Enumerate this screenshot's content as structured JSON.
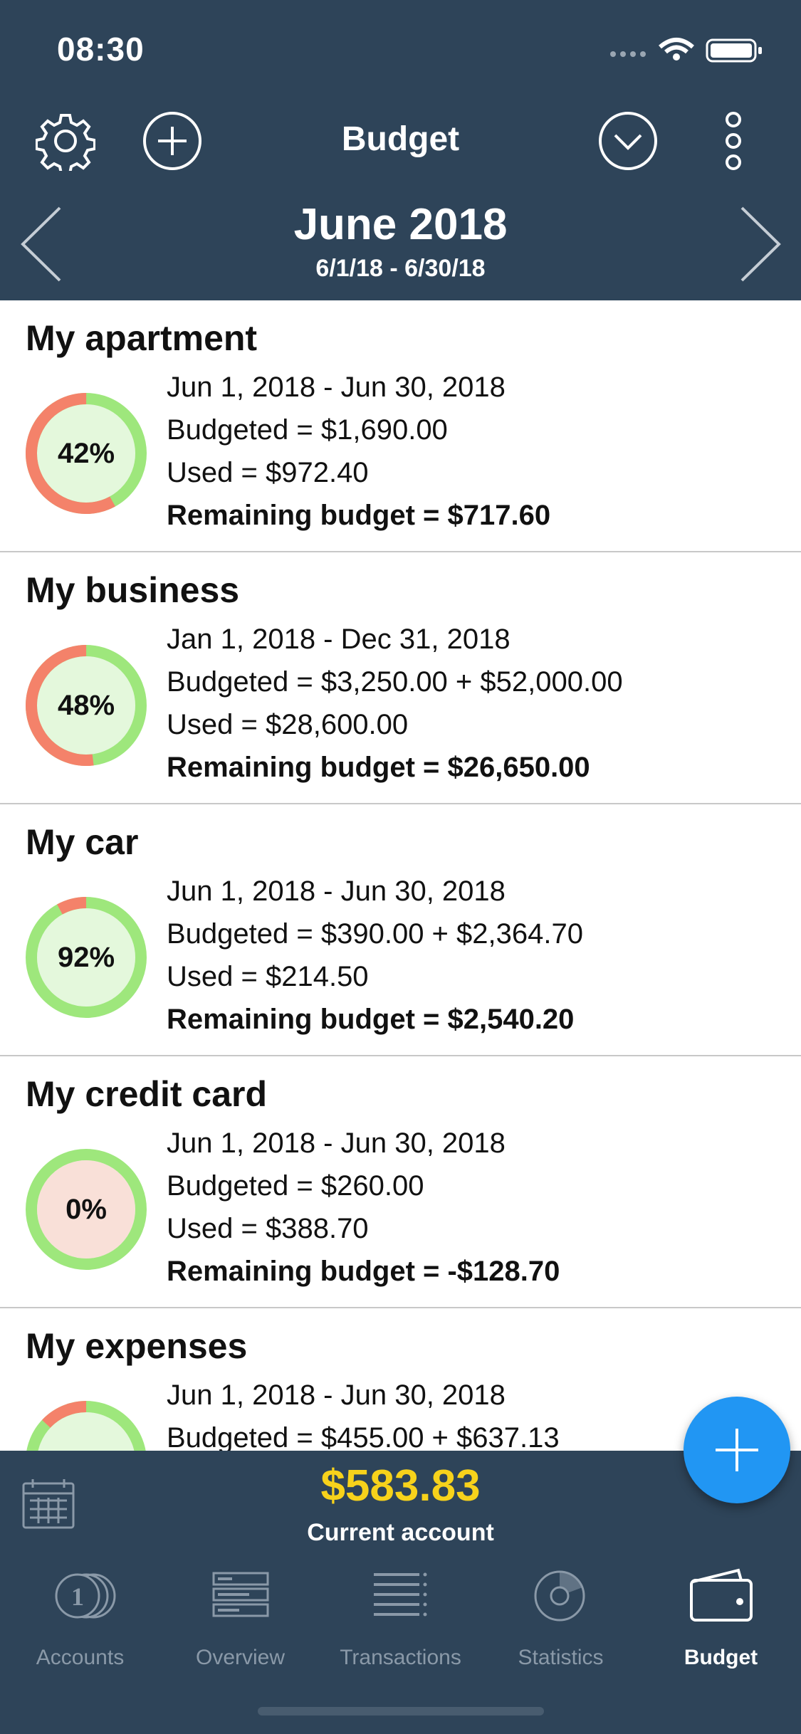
{
  "status_bar": {
    "time": "08:30"
  },
  "header": {
    "title": "Budget",
    "month": "June 2018",
    "range": "6/1/18 - 6/30/18"
  },
  "colors": {
    "header_bg": "#2e4459",
    "used": "#f4826a",
    "remaining": "#9ee77c",
    "fab": "#2196f3",
    "amount": "#f7d21b"
  },
  "budgets": [
    {
      "name": "My apartment",
      "percent_label": "42%",
      "percent": 42,
      "period": "Jun 1, 2018 - Jun 30, 2018",
      "budgeted": "Budgeted = $1,690.00",
      "used": "Used = $972.40",
      "remaining": "Remaining budget = $717.60",
      "overrun": false
    },
    {
      "name": "My business",
      "percent_label": "48%",
      "percent": 48,
      "period": "Jan 1, 2018 - Dec 31, 2018",
      "budgeted": "Budgeted = $3,250.00 + $52,000.00",
      "used": "Used = $28,600.00",
      "remaining": "Remaining budget = $26,650.00",
      "overrun": false
    },
    {
      "name": "My car",
      "percent_label": "92%",
      "percent": 92,
      "period": "Jun 1, 2018 - Jun 30, 2018",
      "budgeted": "Budgeted = $390.00 + $2,364.70",
      "used": "Used = $214.50",
      "remaining": "Remaining budget = $2,540.20",
      "overrun": false
    },
    {
      "name": "My credit card",
      "percent_label": "0%",
      "percent": 100,
      "period": "Jun 1, 2018 - Jun 30, 2018",
      "budgeted": "Budgeted = $260.00",
      "used": "Used = $388.70",
      "remaining": "Remaining budget = -$128.70",
      "overrun": true
    },
    {
      "name": "My expenses",
      "percent_label": "",
      "percent": 87,
      "period": "Jun 1, 2018 - Jun 30, 2018",
      "budgeted": "Budgeted = $455.00 + $637.13",
      "used": "",
      "remaining": "",
      "overrun": false
    }
  ],
  "footer": {
    "amount": "$583.83",
    "account": "Current account"
  },
  "tabs": [
    {
      "label": "Accounts",
      "icon": "coins-icon",
      "active": false
    },
    {
      "label": "Overview",
      "icon": "overview-icon",
      "active": false
    },
    {
      "label": "Transactions",
      "icon": "list-icon",
      "active": false
    },
    {
      "label": "Statistics",
      "icon": "pie-chart-icon",
      "active": false
    },
    {
      "label": "Budget",
      "icon": "wallet-icon",
      "active": true
    }
  ]
}
